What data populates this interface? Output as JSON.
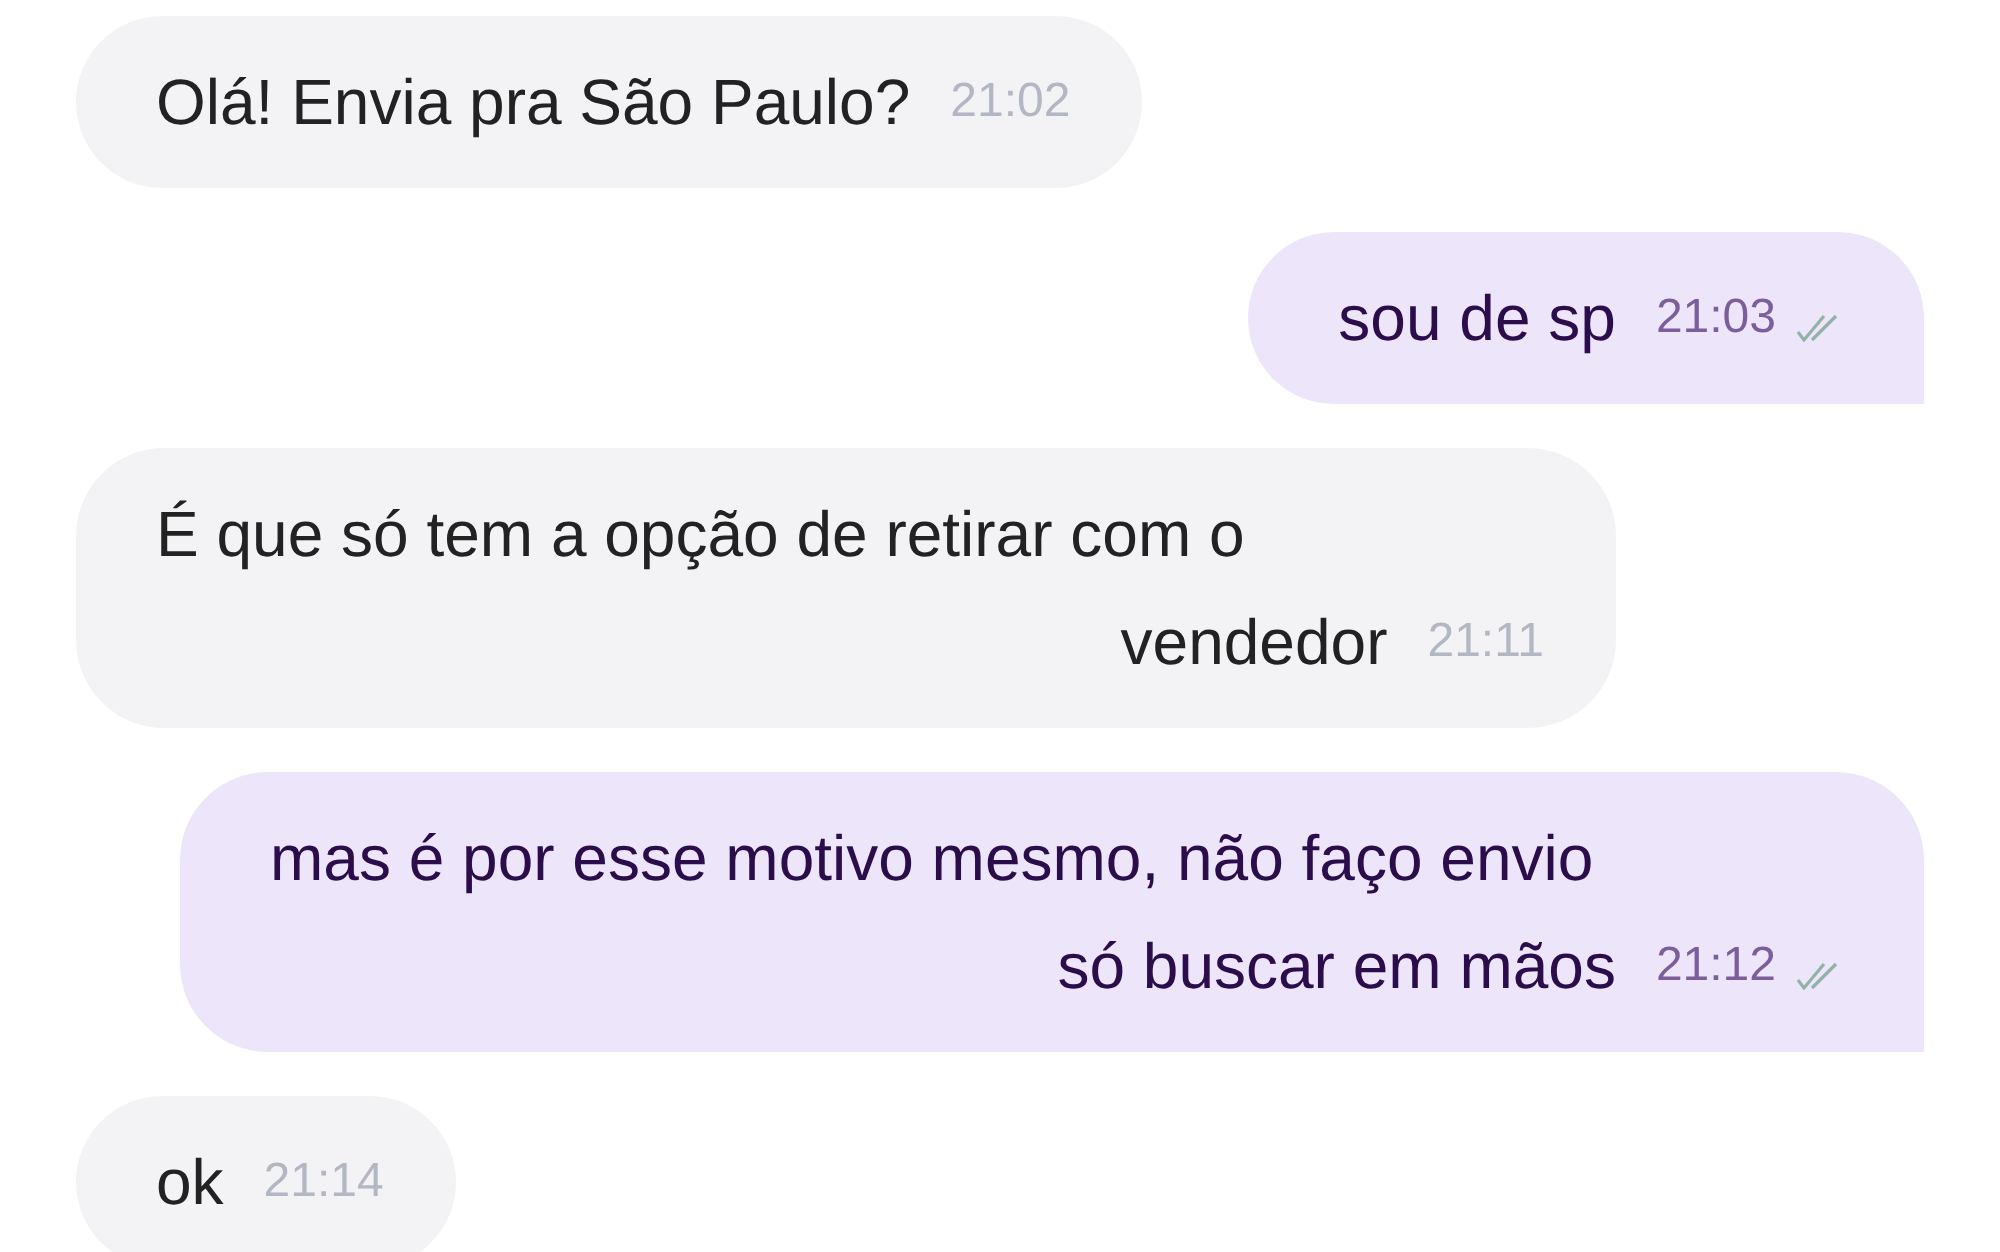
{
  "messages": [
    {
      "kind": "incoming",
      "text": "Olá! Envia pra São Paulo?",
      "time": "21:02"
    },
    {
      "kind": "outgoing",
      "text": "sou de sp",
      "time": "21:03",
      "delivered": true
    },
    {
      "kind": "incoming",
      "text": "É que só tem a opção de retirar com o vendedor",
      "time": "21:11"
    },
    {
      "kind": "outgoing",
      "text": "mas é por esse motivo mesmo, não faço envio só buscar em mãos",
      "time": "21:12",
      "delivered": true
    },
    {
      "kind": "incoming",
      "text": "ok",
      "time": "21:14"
    }
  ]
}
